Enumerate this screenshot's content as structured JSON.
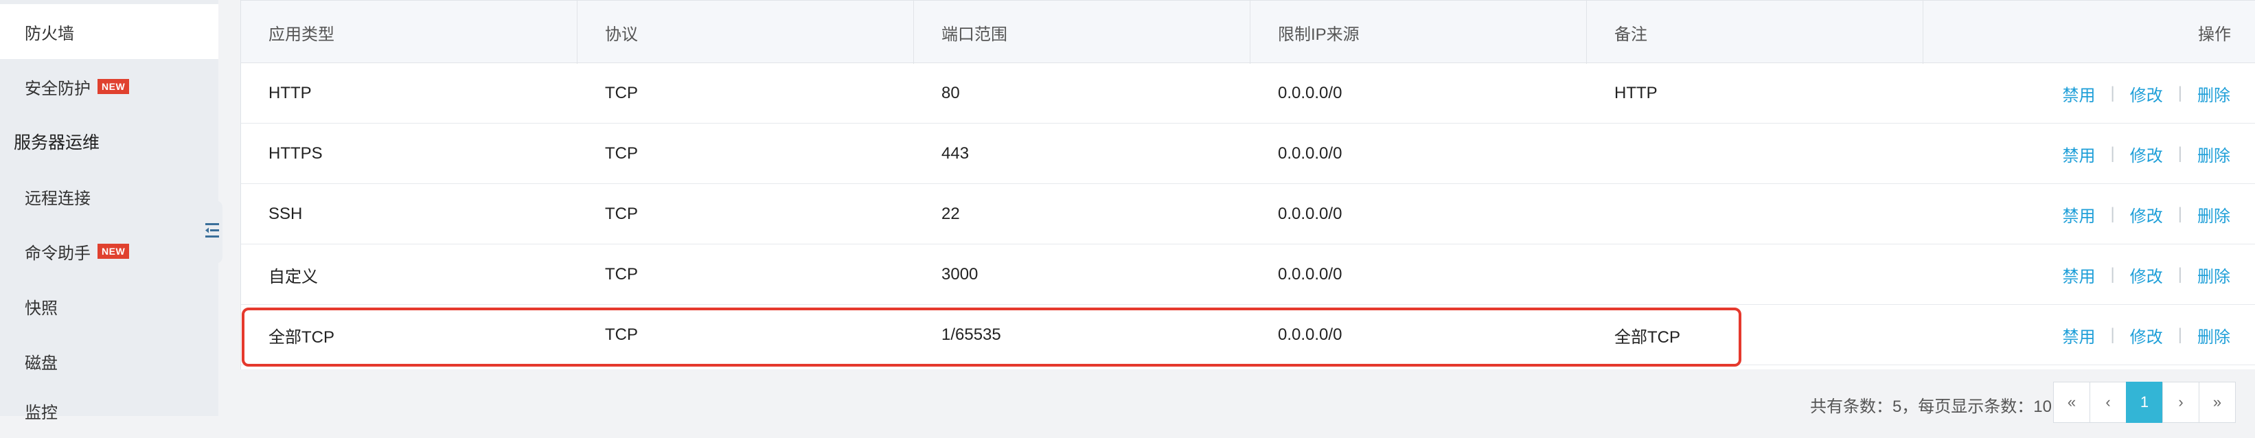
{
  "sidebar": {
    "items": [
      {
        "label": "防火墙",
        "active": true,
        "badge": ""
      },
      {
        "label": "安全防护",
        "active": false,
        "badge": "NEW"
      }
    ],
    "group": {
      "label": "服务器运维"
    },
    "group_items": [
      {
        "label": "远程连接",
        "badge": ""
      },
      {
        "label": "命令助手",
        "badge": "NEW"
      },
      {
        "label": "快照",
        "badge": ""
      },
      {
        "label": "磁盘",
        "badge": ""
      },
      {
        "label": "监控",
        "badge": ""
      }
    ],
    "collapse_icon": "sidebar-collapse-icon"
  },
  "table": {
    "headers": [
      "应用类型",
      "协议",
      "端口范围",
      "限制IP来源",
      "备注",
      "操作"
    ],
    "rows": [
      {
        "app": "HTTP",
        "protocol": "TCP",
        "port": "80",
        "ip": "0.0.0.0/0",
        "note": "HTTP"
      },
      {
        "app": "HTTPS",
        "protocol": "TCP",
        "port": "443",
        "ip": "0.0.0.0/0",
        "note": ""
      },
      {
        "app": "SSH",
        "protocol": "TCP",
        "port": "22",
        "ip": "0.0.0.0/0",
        "note": ""
      },
      {
        "app": "自定义",
        "protocol": "TCP",
        "port": "3000",
        "ip": "0.0.0.0/0",
        "note": ""
      },
      {
        "app": "全部TCP",
        "protocol": "TCP",
        "port": "1/65535",
        "ip": "0.0.0.0/0",
        "note": "全部TCP"
      }
    ],
    "actions": {
      "disable": "禁用",
      "edit": "修改",
      "delete": "删除",
      "separator": "|"
    }
  },
  "pagination": {
    "summary": "共有条数：5，每页显示条数：10",
    "first": "«",
    "prev": "‹",
    "current": "1",
    "next": "›",
    "last": "»"
  },
  "colors": {
    "link": "#1f9fd8",
    "highlight": "#e5392d",
    "badge": "#e0412f",
    "page_active": "#33b5d6"
  }
}
